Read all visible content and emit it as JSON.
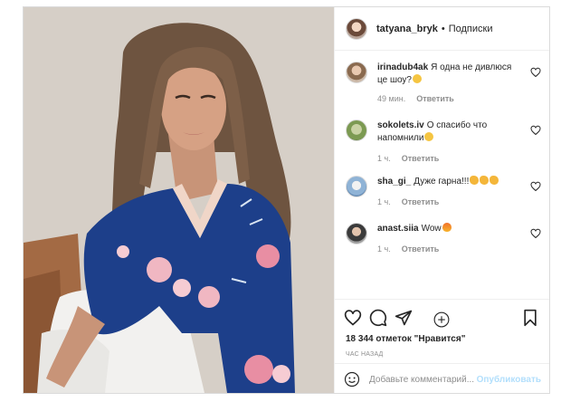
{
  "post": {
    "username": "tatyana_bryk",
    "separator": "•",
    "follow_label": "Подписки"
  },
  "comments": [
    {
      "user": "irinadub4ak",
      "text": "Я одна не дивлюся це шоу?",
      "emoji": "smile",
      "age": "49 мин.",
      "reply_label": "Ответить"
    },
    {
      "user": "sokolets.iv",
      "text": "О спасибо что напомнили",
      "emoji": "smile",
      "age": "1 ч.",
      "reply_label": "Ответить"
    },
    {
      "user": "sha_gi_",
      "text": "Дуже гарна!!!",
      "emoji": "clap",
      "age": "1 ч.",
      "reply_label": "Ответить"
    },
    {
      "user": "anast.siia",
      "text": "Wow",
      "emoji": "fire",
      "age": "1 ч.",
      "reply_label": "Ответить"
    }
  ],
  "actions": {
    "likes_text": "18 344 отметок \"Нравится\"",
    "time_text": "час назад"
  },
  "add_comment": {
    "placeholder": "Добавьте комментарий...",
    "post_label": "Опубликовать"
  },
  "icons": {
    "like": "heart-icon",
    "comment": "comment-icon",
    "share": "share-icon",
    "save": "bookmark-icon",
    "load_more": "plus-circle-icon",
    "emoji_picker": "smiley-icon"
  }
}
